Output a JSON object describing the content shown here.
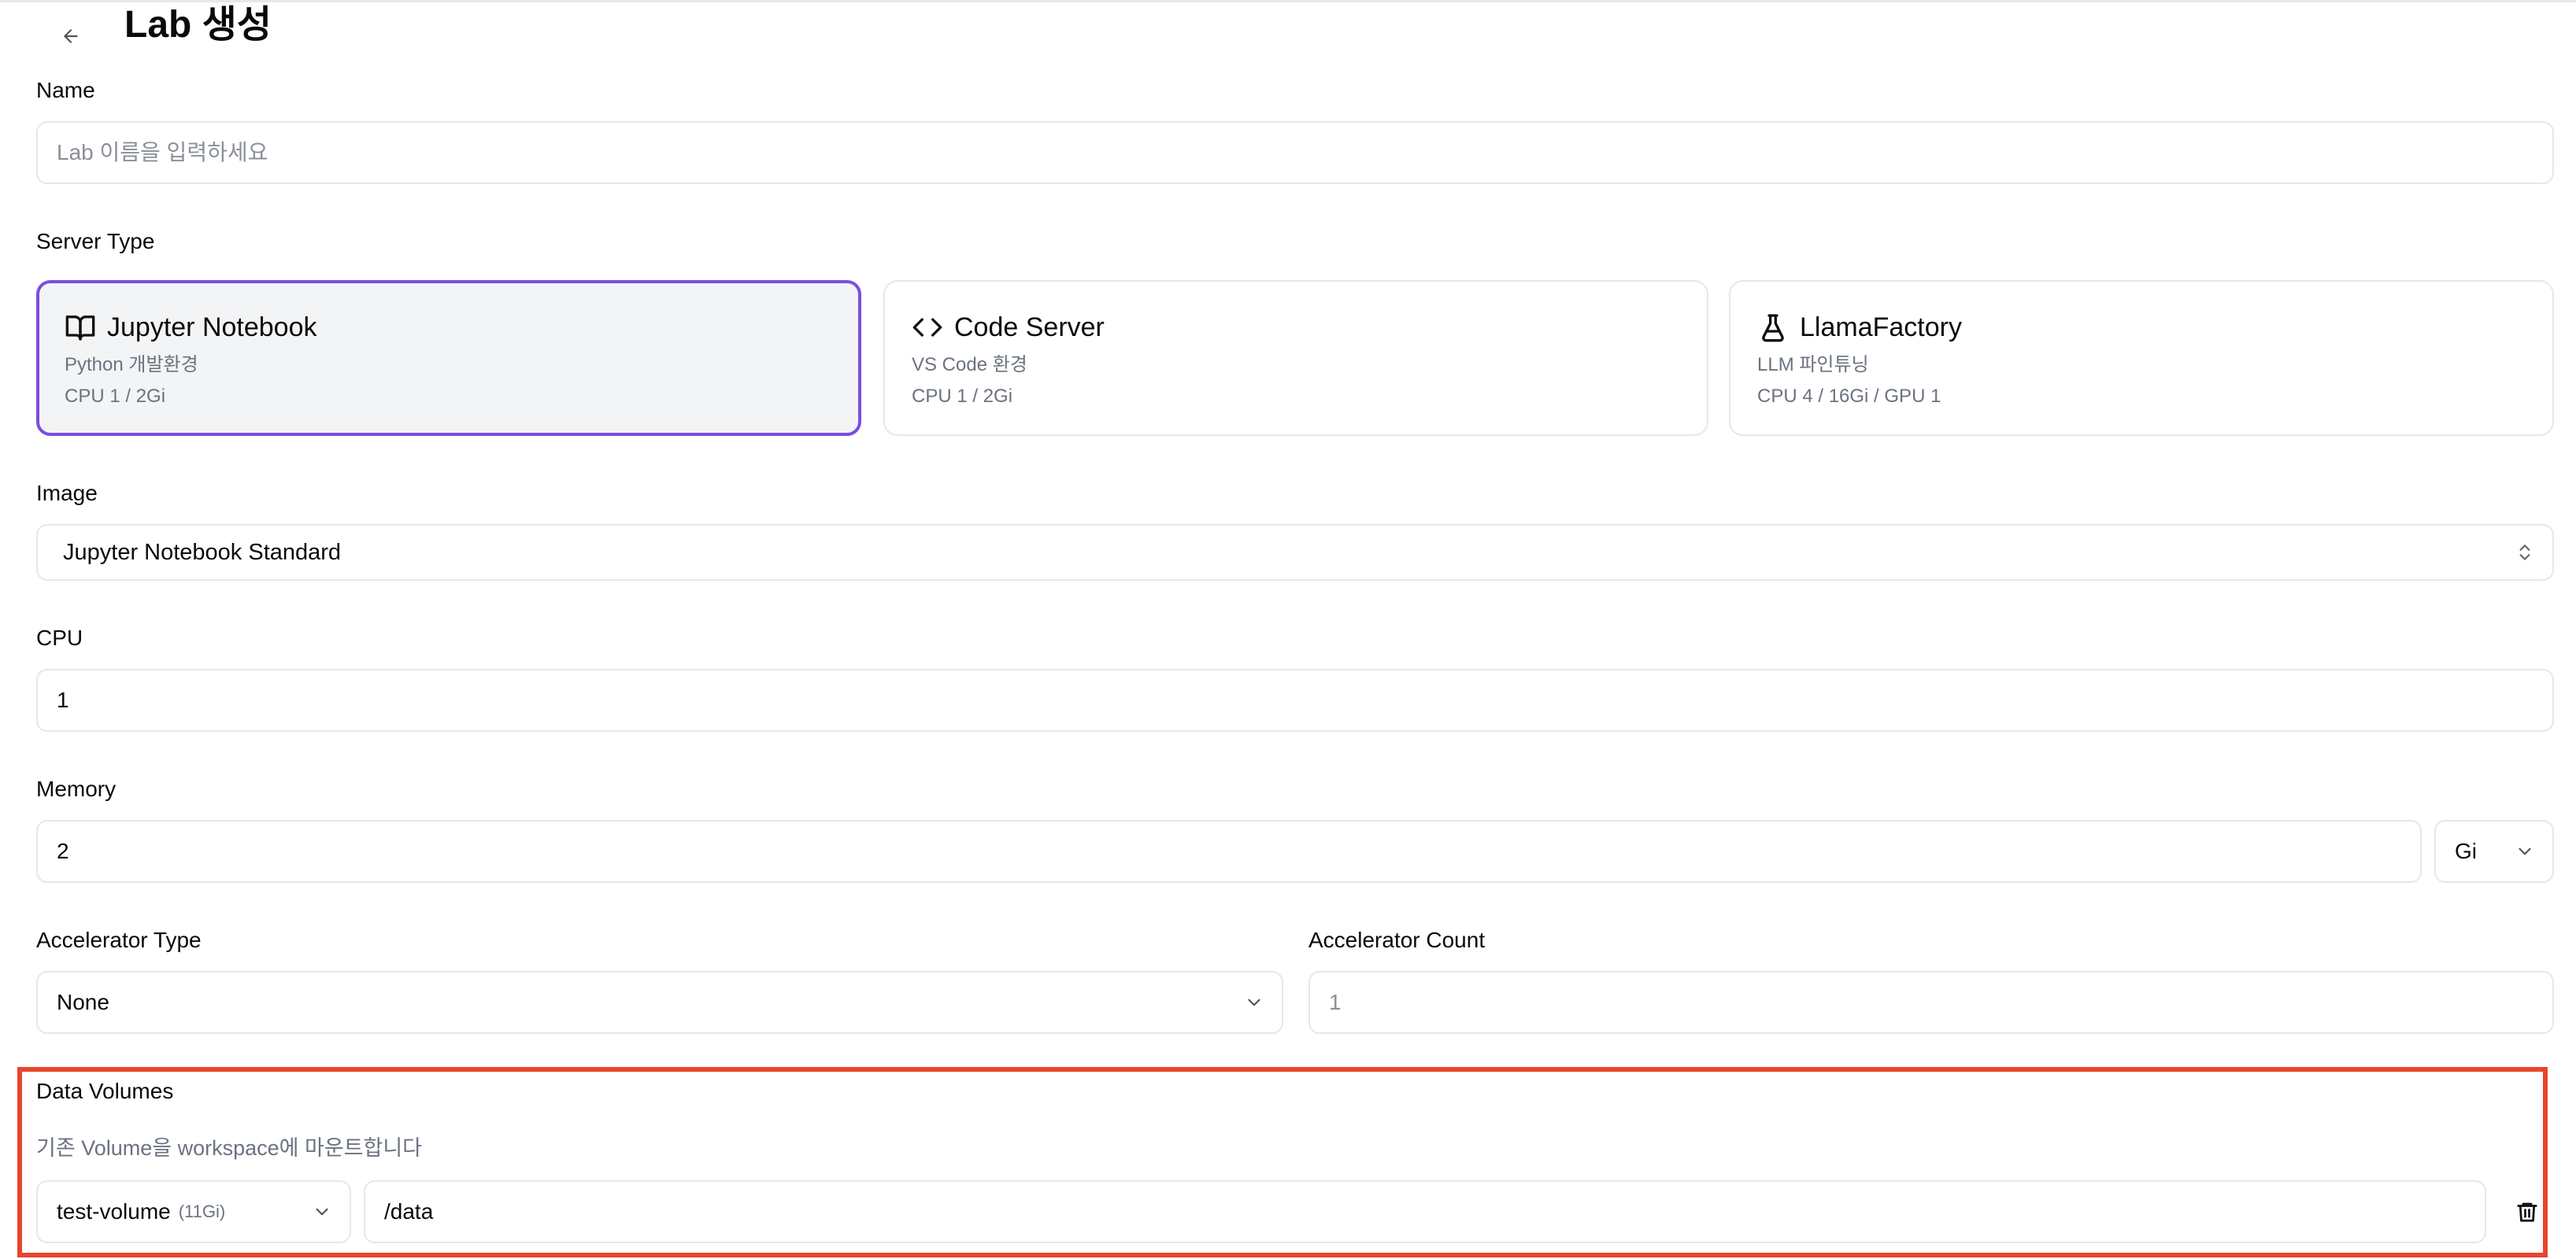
{
  "header": {
    "title": "Lab 생성"
  },
  "name": {
    "label": "Name",
    "placeholder": "Lab 이름을 입력하세요",
    "value": ""
  },
  "server_type": {
    "label": "Server Type",
    "options": [
      {
        "title": "Jupyter Notebook",
        "subtitle": "Python 개발환경",
        "spec": "CPU 1 / 2Gi",
        "icon": "book-open-icon",
        "selected": true
      },
      {
        "title": "Code Server",
        "subtitle": "VS Code 환경",
        "spec": "CPU 1 / 2Gi",
        "icon": "code-icon",
        "selected": false
      },
      {
        "title": "LlamaFactory",
        "subtitle": "LLM 파인튜닝",
        "spec": "CPU 4 / 16Gi / GPU 1",
        "icon": "flask-icon",
        "selected": false
      }
    ]
  },
  "image": {
    "label": "Image",
    "value": "Jupyter Notebook Standard"
  },
  "cpu": {
    "label": "CPU",
    "value": "1"
  },
  "memory": {
    "label": "Memory",
    "value": "2",
    "unit": "Gi"
  },
  "accelerator": {
    "type_label": "Accelerator Type",
    "type_value": "None",
    "count_label": "Accelerator Count",
    "count_value": "1"
  },
  "data_volumes": {
    "label": "Data Volumes",
    "help": "기존 Volume을 workspace에 마운트합니다",
    "volume_name": "test-volume",
    "volume_size": "(11Gi)",
    "mount_path": "/data"
  },
  "colors": {
    "accent": "#7c4ddf",
    "highlight": "#e8452c",
    "border": "#e5e7eb",
    "muted": "#6b7280"
  }
}
